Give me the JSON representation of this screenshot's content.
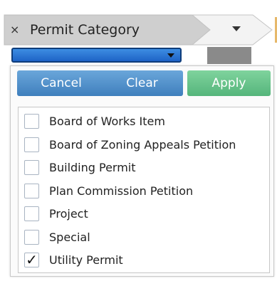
{
  "filter": {
    "chip_close_icon": "×",
    "chip_label": "Permit Category"
  },
  "buttons": {
    "cancel": "Cancel",
    "clear": "Clear",
    "apply": "Apply"
  },
  "items": [
    {
      "label": "Board of Works Item",
      "checked": false
    },
    {
      "label": "Board of Zoning Appeals Petition",
      "checked": false
    },
    {
      "label": "Building Permit",
      "checked": false
    },
    {
      "label": "Plan Commission Petition",
      "checked": false
    },
    {
      "label": "Project",
      "checked": false
    },
    {
      "label": "Special",
      "checked": false
    },
    {
      "label": "Utility Permit",
      "checked": true
    }
  ],
  "check_mark": "✓",
  "colors": {
    "button_blue": "#4f8ecb",
    "button_green": "#66c48a",
    "select_blue": "#2a74d4"
  }
}
